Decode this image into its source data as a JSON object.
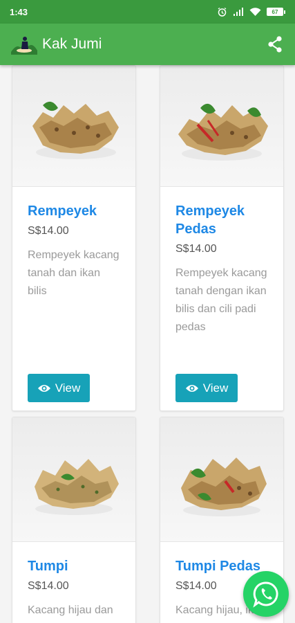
{
  "status_bar": {
    "time": "1:43",
    "battery": "67"
  },
  "app_bar": {
    "title": "Kak Jumi"
  },
  "products": [
    {
      "name": "Rempeyek",
      "price": "S$14.00",
      "description": "Rempeyek kacang tanah dan ikan bilis",
      "view_label": "View"
    },
    {
      "name": "Rempeyek Pedas",
      "price": "S$14.00",
      "description": "Rempeyek kacang tanah dengan ikan bilis dan cili padi pedas",
      "view_label": "View"
    },
    {
      "name": "Tumpi",
      "price": "S$14.00",
      "description": "Kacang hijau dan"
    },
    {
      "name": "Tumpi Pedas",
      "price": "S$14.00",
      "description": "Kacang hijau, ikan"
    }
  ],
  "icons": {
    "share": "share-icon",
    "view": "eye-icon",
    "chat": "whatsapp-icon"
  },
  "colors": {
    "status_bar": "#3a9a3e",
    "app_bar": "#4caf50",
    "title": "#1e88e5",
    "button": "#17a2b8",
    "whatsapp": "#25d366"
  }
}
